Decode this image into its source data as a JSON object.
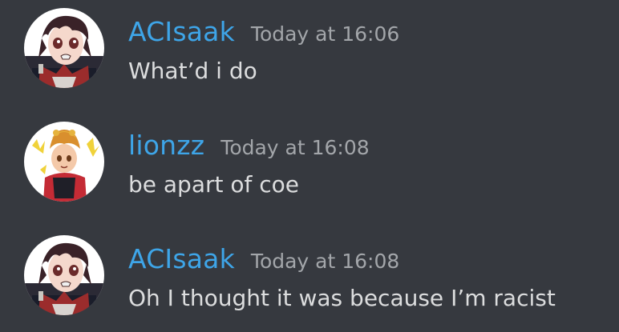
{
  "theme": {
    "background": "#36393f",
    "username_color": "#3ea5e8",
    "timestamp_color": "#a3a6aa",
    "text_color": "#dcddde"
  },
  "messages": [
    {
      "author": "ACIsaak",
      "timestamp": "Today at 16:06",
      "content": "What’d i do",
      "avatar": "anime-boy-avatar-icon"
    },
    {
      "author": "lionzz",
      "timestamp": "Today at 16:08",
      "content": "be apart of coe",
      "avatar": "lion-hat-character-avatar-icon"
    },
    {
      "author": "ACIsaak",
      "timestamp": "Today at 16:08",
      "content": "Oh I thought it was because I’m racist",
      "avatar": "anime-boy-avatar-icon"
    }
  ]
}
